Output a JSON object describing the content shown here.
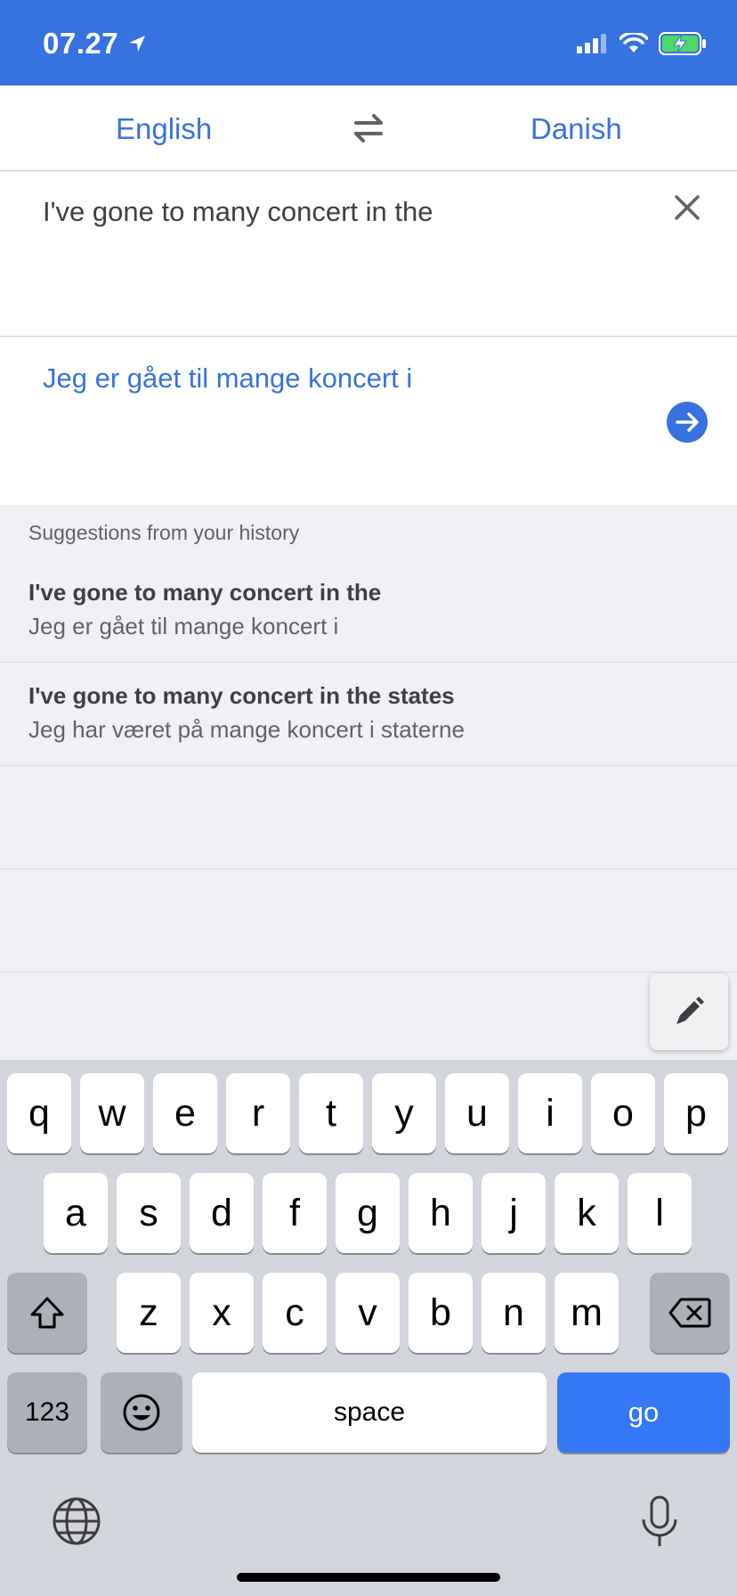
{
  "status_bar": {
    "time": "07.27",
    "bg_color": "#3673e0"
  },
  "languages": {
    "source": "English",
    "target": "Danish"
  },
  "input": {
    "text": "I've gone to many concert in the"
  },
  "output": {
    "text": "Jeg er gået til mange koncert i"
  },
  "suggestions": {
    "header": "Suggestions from your history",
    "items": [
      {
        "source": "I've gone to many concert in the",
        "target": "Jeg er gået til mange koncert i"
      },
      {
        "source": "I've gone to many concert in the states",
        "target": "Jeg har været på mange koncert i staterne"
      }
    ]
  },
  "keyboard": {
    "row1": [
      "q",
      "w",
      "e",
      "r",
      "t",
      "y",
      "u",
      "i",
      "o",
      "p"
    ],
    "row2": [
      "a",
      "s",
      "d",
      "f",
      "g",
      "h",
      "j",
      "k",
      "l"
    ],
    "row3": [
      "z",
      "x",
      "c",
      "v",
      "b",
      "n",
      "m"
    ],
    "numbers_label": "123",
    "space_label": "space",
    "go_label": "go"
  },
  "icons": [
    "location-arrow-icon",
    "signal-icon",
    "wifi-icon",
    "battery-charging-icon",
    "swap-icon",
    "close-icon",
    "arrow-right-circle-icon",
    "pen-icon",
    "shift-icon",
    "backspace-icon",
    "emoji-icon",
    "globe-icon",
    "microphone-icon"
  ],
  "colors": {
    "accent": "#3673e0",
    "go_key": "#3478f6"
  }
}
